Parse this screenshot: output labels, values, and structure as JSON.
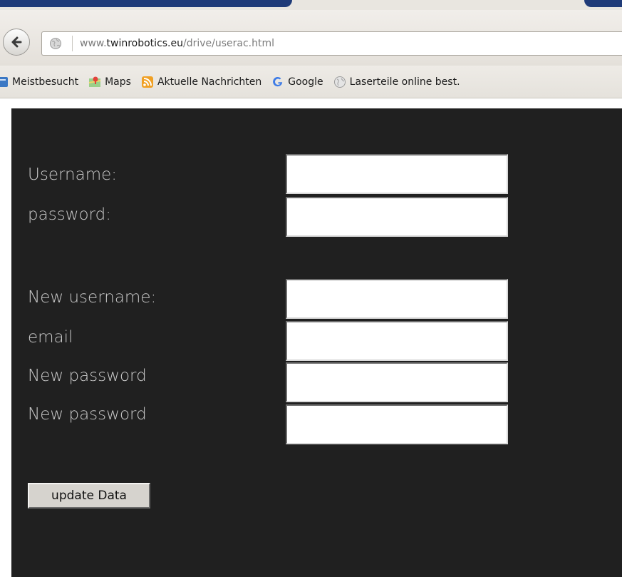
{
  "browser": {
    "url_prefix": "www.",
    "url_host": "twinrobotics.eu",
    "url_path": "/drive/userac.html",
    "bookmarks": [
      {
        "label": "Meistbesucht",
        "icon": "bookmark-folder-icon"
      },
      {
        "label": "Maps",
        "icon": "maps-icon"
      },
      {
        "label": "Aktuelle Nachrichten",
        "icon": "rss-feed-icon"
      },
      {
        "label": "Google",
        "icon": "google-icon"
      },
      {
        "label": "Laserteile online best.",
        "icon": "globe-icon"
      }
    ]
  },
  "form": {
    "username_label": "Username:",
    "password_label": "password:",
    "new_username_label": "New username:",
    "email_label": "email",
    "new_password_label": "New password",
    "new_password_repeat_label": "New password",
    "username_value": "",
    "password_value": "",
    "new_username_value": "",
    "email_value": "",
    "new_password_value": "",
    "new_password_repeat_value": "",
    "submit_label": "update Data"
  },
  "colors": {
    "page_background": "#202020",
    "label_text": "#c9c9c9"
  }
}
